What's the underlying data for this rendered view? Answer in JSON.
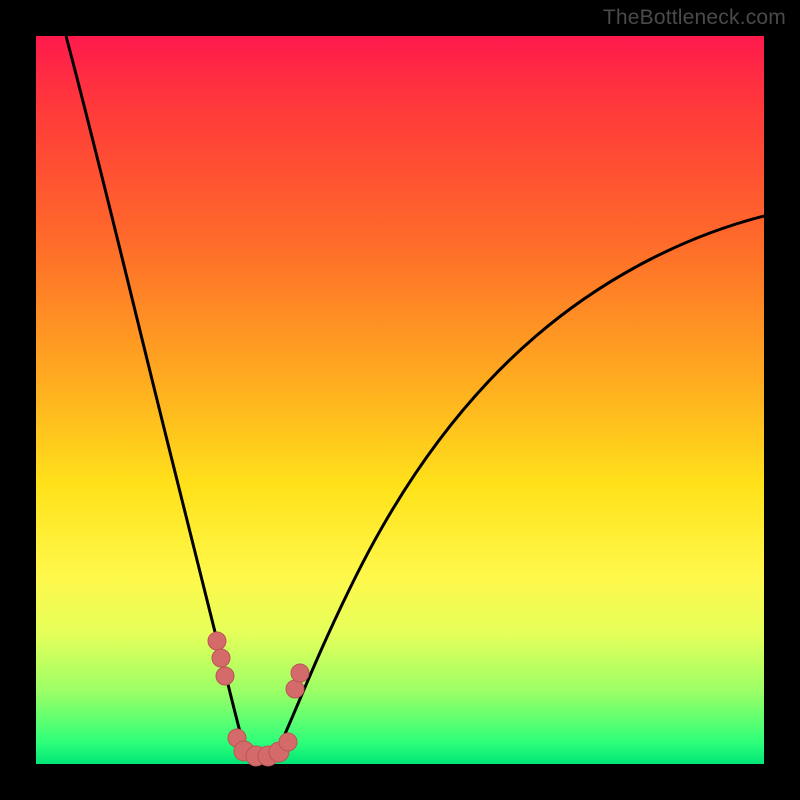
{
  "watermark": "TheBottleneck.com",
  "colors": {
    "frame": "#000000",
    "curve": "#000000",
    "marker_fill": "#d46a6a",
    "marker_stroke": "#bb5555",
    "gradient_top": "#ff1a4d",
    "gradient_bottom": "#00e676"
  },
  "chart_data": {
    "type": "line",
    "title": "",
    "xlabel": "",
    "ylabel": "",
    "xlim": [
      0,
      100
    ],
    "ylim": [
      0,
      100
    ],
    "description": "Bottleneck-style V curve. Y is percentage bottleneck (0 at bottom = no bottleneck, 100 at top). X is component balance point. Two branches meet at a flat minimum near x≈27 (y≈0). Left branch falls steeply from top-left; right branch rises toward upper-right.",
    "series": [
      {
        "name": "left-branch",
        "x": [
          5,
          8,
          11,
          14,
          17,
          19,
          21,
          23,
          25,
          27
        ],
        "y": [
          100,
          86,
          70,
          54,
          38,
          26,
          16,
          8,
          3,
          0
        ]
      },
      {
        "name": "right-branch",
        "x": [
          30,
          34,
          40,
          48,
          58,
          70,
          84,
          100
        ],
        "y": [
          0,
          4,
          12,
          24,
          38,
          52,
          64,
          74
        ]
      }
    ],
    "markers": [
      {
        "x": 21.0,
        "y": 16.0,
        "series": "left-branch"
      },
      {
        "x": 21.8,
        "y": 13.0,
        "series": "left-branch"
      },
      {
        "x": 22.5,
        "y": 10.0,
        "series": "left-branch"
      },
      {
        "x": 25.0,
        "y": 1.5,
        "series": "floor"
      },
      {
        "x": 26.5,
        "y": 0.6,
        "series": "floor"
      },
      {
        "x": 28.0,
        "y": 0.6,
        "series": "floor"
      },
      {
        "x": 29.5,
        "y": 0.6,
        "series": "floor"
      },
      {
        "x": 31.0,
        "y": 1.0,
        "series": "floor"
      },
      {
        "x": 32.0,
        "y": 2.0,
        "series": "floor"
      },
      {
        "x": 31.0,
        "y": 10.0,
        "series": "right-branch"
      },
      {
        "x": 31.8,
        "y": 13.0,
        "series": "right-branch"
      }
    ]
  }
}
